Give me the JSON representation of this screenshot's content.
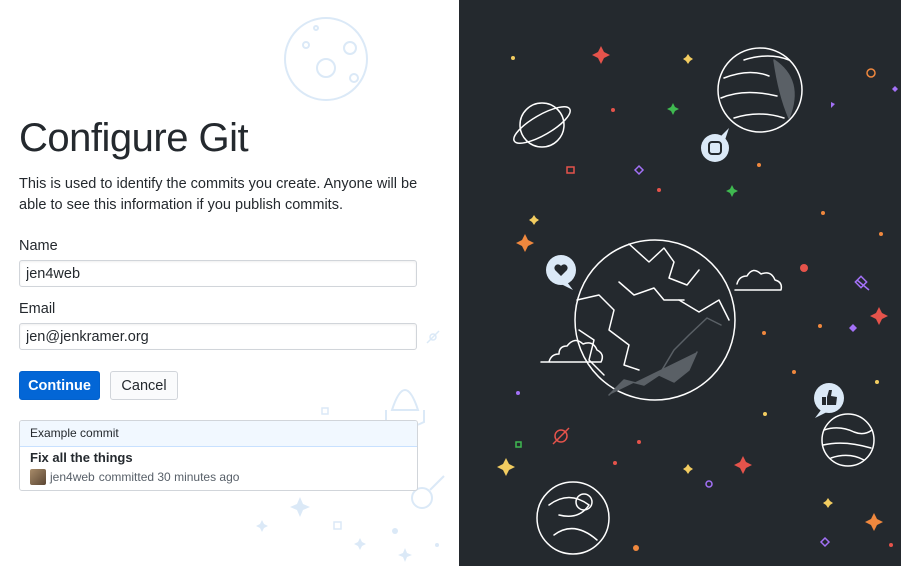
{
  "page": {
    "title": "Configure Git",
    "description": "This is used to identify the commits you create. Anyone will be able to see this information if you publish commits."
  },
  "form": {
    "name_label": "Name",
    "name_value": "jen4web",
    "email_label": "Email",
    "email_value": "jen@jenkramer.org"
  },
  "buttons": {
    "continue": "Continue",
    "cancel": "Cancel"
  },
  "example_commit": {
    "header": "Example commit",
    "title": "Fix all the things",
    "author": "jen4web",
    "meta": "committed 30 minutes ago"
  },
  "colors": {
    "primary": "#0366d6",
    "dark_panel": "#24292e",
    "illustration_line": "#dbe9f7"
  },
  "icons": [
    "moon-icon",
    "rocket-icon",
    "comet-icon",
    "satellite-icon",
    "earth-illustration",
    "planet-icon",
    "saturn-icon",
    "heart-bubble-icon",
    "octocat-bubble-icon",
    "thumbs-up-bubble-icon",
    "cloud-icon",
    "star-icon"
  ]
}
